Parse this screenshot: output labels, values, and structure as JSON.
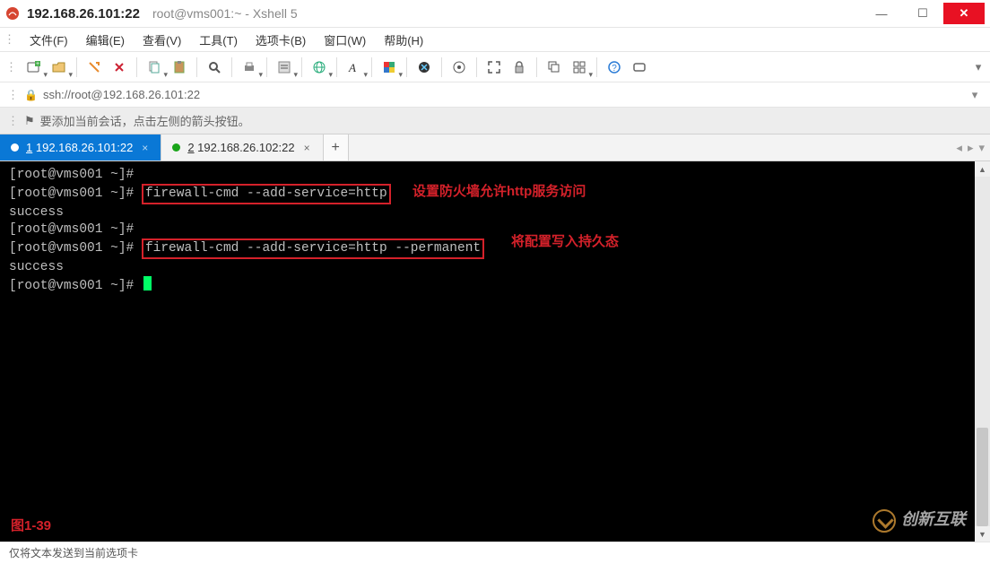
{
  "window": {
    "title_main": "192.168.26.101:22",
    "title_sub": "root@vms001:~ - Xshell 5"
  },
  "menu": {
    "file": "文件(F)",
    "edit": "编辑(E)",
    "view": "查看(V)",
    "tools": "工具(T)",
    "tabs": "选项卡(B)",
    "window": "窗口(W)",
    "help": "帮助(H)"
  },
  "toolbar_icons": {
    "new_session": "new-session-icon",
    "open": "open-folder-icon",
    "reconnect": "reconnect-icon",
    "disconnect": "disconnect-icon",
    "copy": "copy-icon",
    "paste": "paste-icon",
    "find": "find-icon",
    "print": "print-icon",
    "properties": "properties-icon",
    "transfer": "globe-icon",
    "font": "font-icon",
    "color": "color-scheme-icon",
    "xagent": "xagent-icon",
    "fullscreen": "fullscreen-icon",
    "lock": "lock-icon",
    "cascade": "cascade-icon",
    "tile": "tile-icon",
    "help": "help-icon",
    "compose": "compose-bar-icon"
  },
  "address": {
    "value": "ssh://root@192.168.26.101:22"
  },
  "hint": {
    "text": "要添加当前会话，点击左侧的箭头按钮。"
  },
  "tabs": {
    "active": {
      "index": "1",
      "label": "192.168.26.101:22"
    },
    "inactive": {
      "index": "2",
      "label": "192.168.26.102:22"
    },
    "add": "+"
  },
  "terminal": {
    "prompt": "[root@vms001 ~]#",
    "cmd1": "firewall-cmd --add-service=http",
    "cmd2": "firewall-cmd --add-service=http --permanent",
    "success": "success",
    "annot1": "设置防火墙允许http服务访问",
    "annot2": "将配置写入持久态",
    "figure_label": "图1-39"
  },
  "watermark": {
    "text": "创新互联"
  },
  "status": {
    "text": "仅将文本发送到当前选项卡"
  }
}
